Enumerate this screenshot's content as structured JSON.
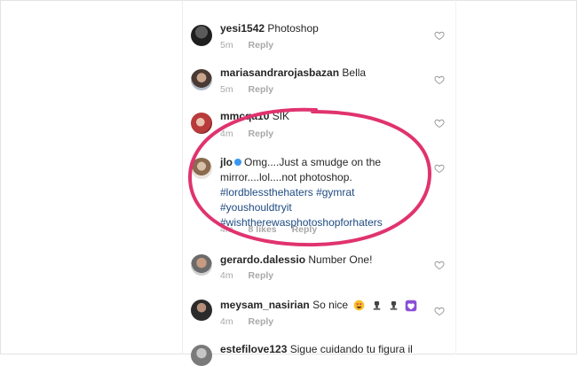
{
  "comments": [
    {
      "username": "yesi1542",
      "text": "Photoshop",
      "time": "5m",
      "reply": "Reply",
      "avatar": "avatar-dark"
    },
    {
      "username": "mariasandrarojasbazan",
      "text": "Bella",
      "time": "5m",
      "reply": "Reply",
      "avatar": "avatar-woman"
    },
    {
      "username": "mmcqa10",
      "text": "SIK",
      "time": "4m",
      "reply": "Reply",
      "avatar": "avatar-red"
    },
    {
      "username": "jlo",
      "verified": true,
      "text_line1": "Omg....Just a smudge on the",
      "text_line2": "mirror....lol....not photoshop.",
      "hashtags_line1": "#lordblessthehaters #gymrat",
      "hashtags_line2": "#youshouldtryit",
      "hashtags_line3": "#wishtherewasphotoshopforhaters",
      "time": "4m",
      "likes": "8 likes",
      "reply": "Reply",
      "avatar": "avatar-jlo"
    },
    {
      "username": "gerardo.dalessio",
      "text": "Number One!",
      "time": "4m",
      "reply": "Reply",
      "avatar": "avatar-man"
    },
    {
      "username": "meysam_nasirian",
      "text": "So nice",
      "time": "4m",
      "reply": "Reply",
      "avatar": "avatar-dark2",
      "emojis": [
        "grinning-heart-eyes-emoji",
        "raised-fist-emoji",
        "raised-fist-emoji",
        "purple-heart-emoji"
      ]
    },
    {
      "username": "estefilove123",
      "text": "Sigue cuidando tu figura il",
      "avatar": "avatar-bottom"
    }
  ],
  "annotation": {
    "color": "#e0336f",
    "shape": "ellipse"
  },
  "colors": {
    "hashtag": "#1e4b80",
    "verified": "#3897f0",
    "muted": "#a8a8a8"
  }
}
